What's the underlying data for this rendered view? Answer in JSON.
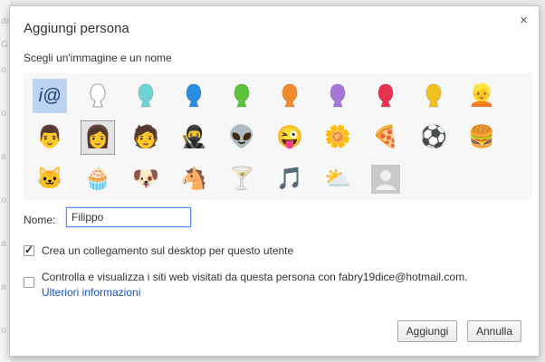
{
  "background": {
    "fragments": [
      "da",
      "G",
      "o",
      "o",
      "a",
      "o",
      "a",
      "a",
      "o"
    ]
  },
  "dialog": {
    "title": "Aggiungi persona",
    "close_glyph": "×",
    "subtitle": "Scegli un'immagine e un nome",
    "avatars": [
      {
        "name": "avatar-generic-icon",
        "glyph": "i@"
      },
      {
        "name": "avatar-white-silhouette-icon",
        "color": "#ffffff",
        "stroke": "#9a9a9a"
      },
      {
        "name": "avatar-cyan-silhouette-icon",
        "color": "#6fd3d3"
      },
      {
        "name": "avatar-blue-silhouette-icon",
        "color": "#2a8ee0"
      },
      {
        "name": "avatar-green-silhouette-icon",
        "color": "#5cc43a"
      },
      {
        "name": "avatar-orange-silhouette-icon",
        "color": "#f28a2b"
      },
      {
        "name": "avatar-purple-silhouette-icon",
        "color": "#a677d9"
      },
      {
        "name": "avatar-red-silhouette-icon",
        "color": "#e8314e"
      },
      {
        "name": "avatar-yellow-silhouette-icon",
        "color": "#f4c21f"
      },
      {
        "name": "avatar-blonde-woman-icon",
        "glyph": "👱"
      },
      {
        "name": "avatar-businessman-icon",
        "glyph": "👨"
      },
      {
        "name": "avatar-woman-sunglasses-icon",
        "glyph": "👩"
      },
      {
        "name": "avatar-man-icon",
        "glyph": "🧑"
      },
      {
        "name": "avatar-ninja-icon",
        "glyph": "🥷"
      },
      {
        "name": "avatar-alien-icon",
        "glyph": "👽"
      },
      {
        "name": "avatar-smiley-icon",
        "glyph": "😜"
      },
      {
        "name": "avatar-flower-icon",
        "glyph": "🌼"
      },
      {
        "name": "avatar-pizza-icon",
        "glyph": "🍕"
      },
      {
        "name": "avatar-soccer-ball-icon",
        "glyph": "⚽"
      },
      {
        "name": "avatar-burger-icon",
        "glyph": "🍔"
      },
      {
        "name": "avatar-cat-icon",
        "glyph": "🐱"
      },
      {
        "name": "avatar-cupcake-icon",
        "glyph": "🧁"
      },
      {
        "name": "avatar-dog-icon",
        "glyph": "🐶"
      },
      {
        "name": "avatar-horse-icon",
        "glyph": "🐴"
      },
      {
        "name": "avatar-cocktail-icon",
        "glyph": "🍸"
      },
      {
        "name": "avatar-music-note-icon",
        "glyph": "🎵"
      },
      {
        "name": "avatar-sun-cloud-icon",
        "glyph": "⛅"
      },
      {
        "name": "avatar-placeholder-icon",
        "placeholder": true
      }
    ],
    "selected_avatar_index": 11,
    "name_label": "Nome:",
    "name_value": "Filippo",
    "shortcut_checked": true,
    "shortcut_label": "Crea un collegamento sul desktop per questo utente",
    "supervise_checked": false,
    "supervise_label": "Controlla e visualizza i siti web visitati da questa persona con fabry19dice@hotmail.com.",
    "more_info_link": "Ulteriori informazioni",
    "add_button": "Aggiungi",
    "cancel_button": "Annulla"
  }
}
